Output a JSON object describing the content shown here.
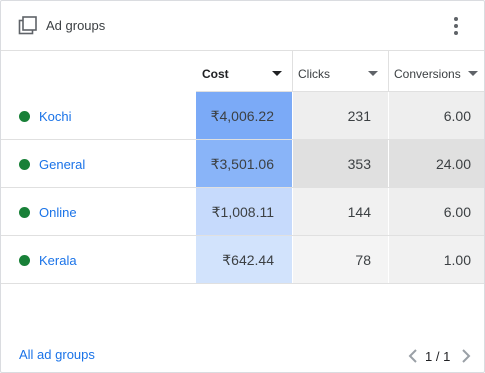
{
  "header": {
    "title": "Ad groups",
    "icon": "layers-icon",
    "menu_icon": "more-vert-icon"
  },
  "columns": [
    {
      "key": "cost",
      "label": "Cost",
      "active": true
    },
    {
      "key": "clicks",
      "label": "Clicks",
      "active": false
    },
    {
      "key": "conversions",
      "label": "Conversions",
      "active": false
    }
  ],
  "rows": [
    {
      "name": "Kochi",
      "status_color": "#188038",
      "cost": "₹4,006.22",
      "clicks": "231",
      "conversions": "6.00"
    },
    {
      "name": "General",
      "status_color": "#188038",
      "cost": "₹3,501.06",
      "clicks": "353",
      "conversions": "24.00"
    },
    {
      "name": "Online",
      "status_color": "#188038",
      "cost": "₹1,008.11",
      "clicks": "144",
      "conversions": "6.00"
    },
    {
      "name": "Kerala",
      "status_color": "#188038",
      "cost": "₹642.44",
      "clicks": "78",
      "conversions": "1.00"
    }
  ],
  "heat": {
    "cost": [
      "#7baaf7",
      "#89b4f8",
      "#c6dafc",
      "#d2e3fc"
    ],
    "clicks": [
      "#eeeeee",
      "#e0e0e0",
      "#f1f1f1",
      "#f4f4f4"
    ],
    "conversions": [
      "#eeeeee",
      "#e0e0e0",
      "#eeeeee",
      "#f1f1f1"
    ]
  },
  "footer": {
    "link_label": "All ad groups",
    "page_indicator": "1 / 1"
  },
  "colors": {
    "accent": "#1a73e8",
    "status_enabled": "#188038"
  }
}
